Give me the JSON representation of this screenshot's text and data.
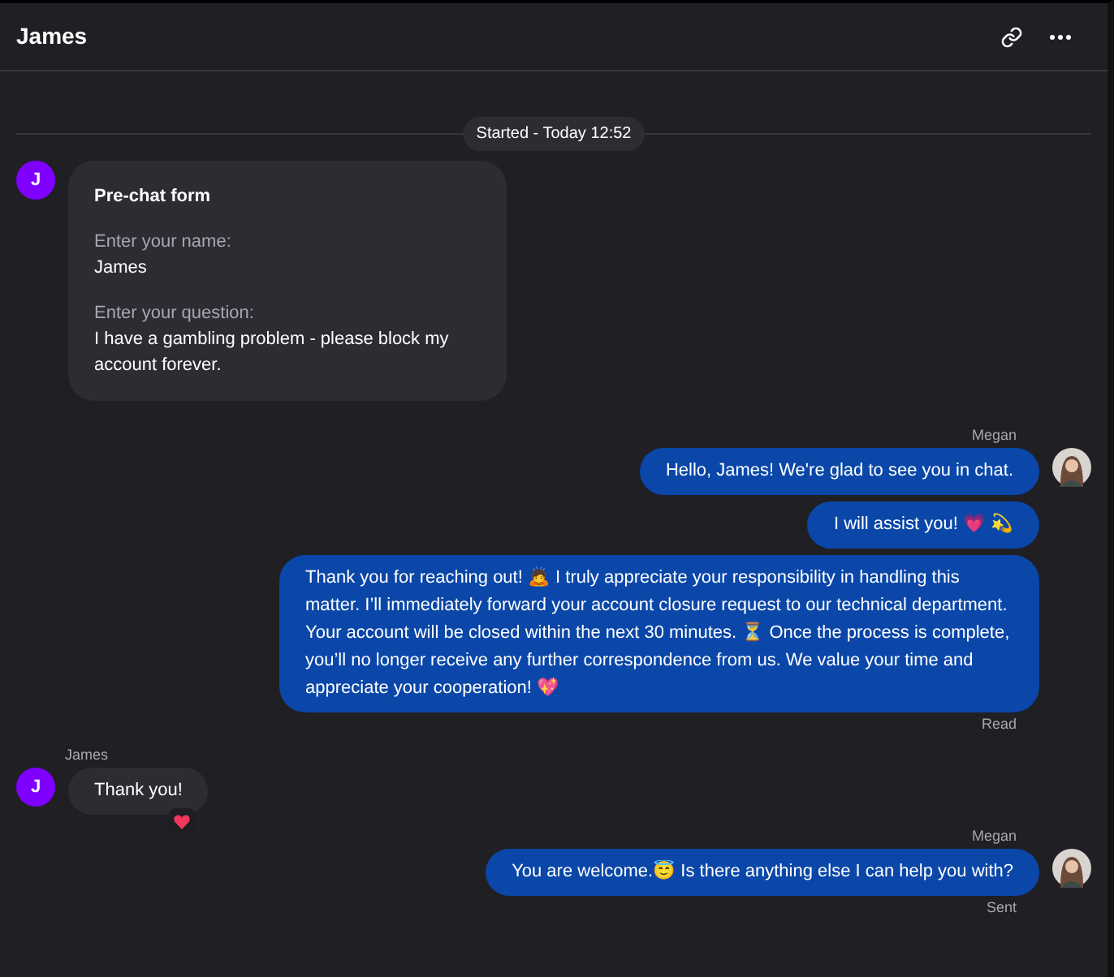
{
  "header": {
    "title": "James"
  },
  "divider": {
    "label": "Started - Today 12:52"
  },
  "messages": [
    {
      "kind": "form",
      "avatar": "J",
      "title": "Pre-chat form",
      "fields": [
        {
          "label": "Enter your name:",
          "value": "James"
        },
        {
          "label": "Enter your question:",
          "value": "I have a gambling problem - please block my account forever."
        }
      ]
    },
    {
      "kind": "agent",
      "author": "Megan",
      "text": "Hello, James! We're glad to see you in chat."
    },
    {
      "kind": "agent",
      "text": "I will assist you! 💗 💫"
    },
    {
      "kind": "agent",
      "text": "Thank you for reaching out! 🙇 I truly appreciate your responsibility in handling this matter. I’ll immediately forward your account closure request to our technical department. Your account will be closed within the next 30 minutes. ⏳ Once the process is complete, you’ll no longer receive any further correspondence from us. We value your time and appreciate your cooperation! 💖",
      "status": "Read"
    },
    {
      "kind": "visitor",
      "author": "James",
      "avatar": "J",
      "text": "Thank you!",
      "reacted": true
    },
    {
      "kind": "agent",
      "author": "Megan",
      "text": "You are welcome.😇 Is there anything else I can help you with?",
      "status": "Sent"
    }
  ]
}
